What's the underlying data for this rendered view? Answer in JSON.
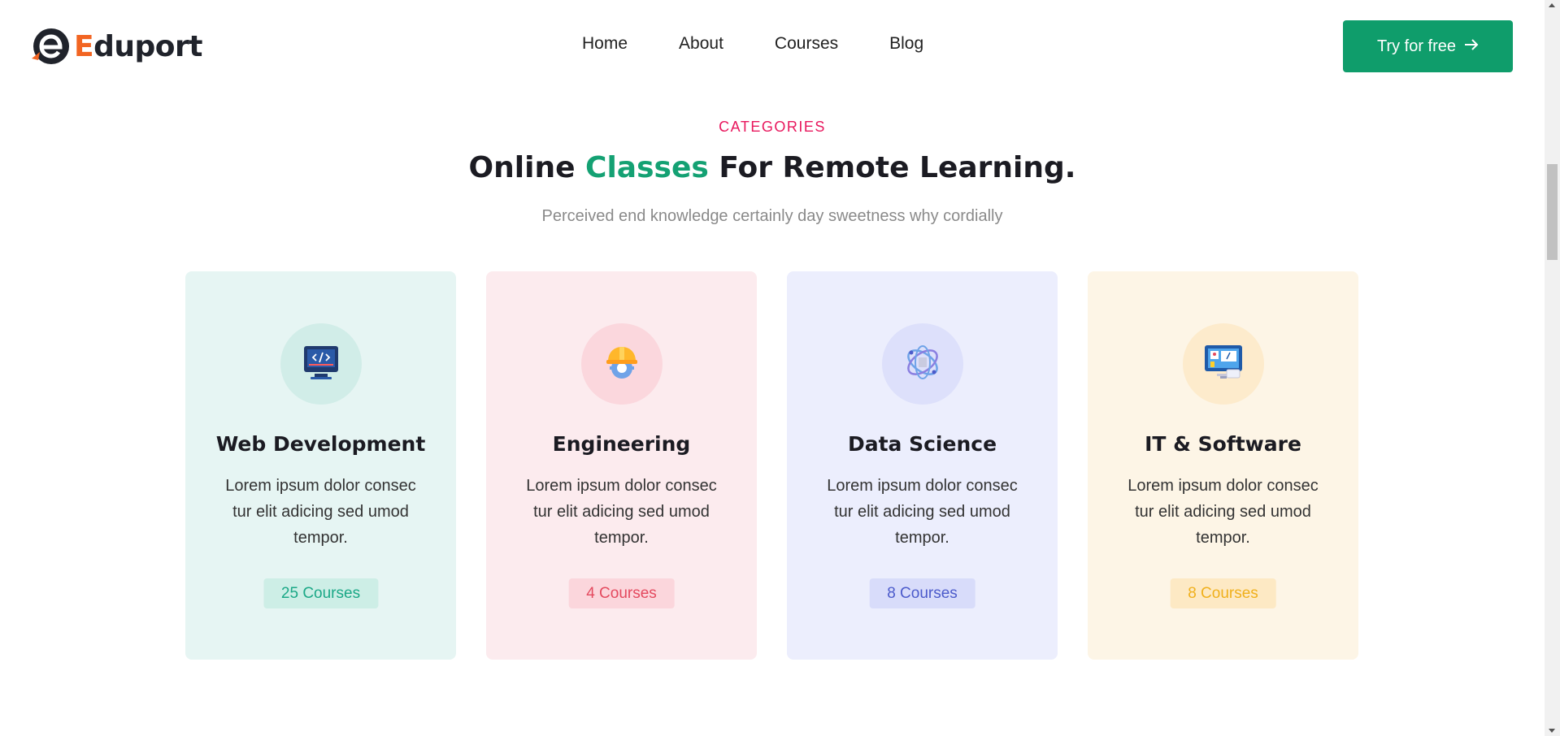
{
  "header": {
    "logo_letter": "E",
    "logo_rest": "duport",
    "nav": [
      {
        "label": "Home"
      },
      {
        "label": "About"
      },
      {
        "label": "Courses"
      },
      {
        "label": "Blog"
      }
    ],
    "cta_label": "Try for free"
  },
  "section": {
    "kicker": "CATEGORIES",
    "title_part1": "Online ",
    "title_accent": "Classes",
    "title_part2": " For Remote Learning.",
    "subtitle": "Perceived end knowledge certainly day sweetness why cordially"
  },
  "cards": [
    {
      "title": "Web Development",
      "description": "Lorem ipsum dolor consec tur elit adicing sed umod tempor.",
      "badge": "25 Courses",
      "icon": "code-screen-icon"
    },
    {
      "title": "Engineering",
      "description": "Lorem ipsum dolor consec tur elit adicing sed umod tempor.",
      "badge": "4 Courses",
      "icon": "hardhat-gear-icon"
    },
    {
      "title": "Data Science",
      "description": "Lorem ipsum dolor consec tur elit adicing sed umod tempor.",
      "badge": "8 Courses",
      "icon": "data-globe-icon"
    },
    {
      "title": "IT & Software",
      "description": "Lorem ipsum dolor consec tur elit adicing sed umod tempor.",
      "badge": "8 Courses",
      "icon": "monitor-software-icon"
    }
  ],
  "colors": {
    "brand_green": "#0f9d6b",
    "brand_orange": "#f26522",
    "kicker_pink": "#e8175d"
  }
}
